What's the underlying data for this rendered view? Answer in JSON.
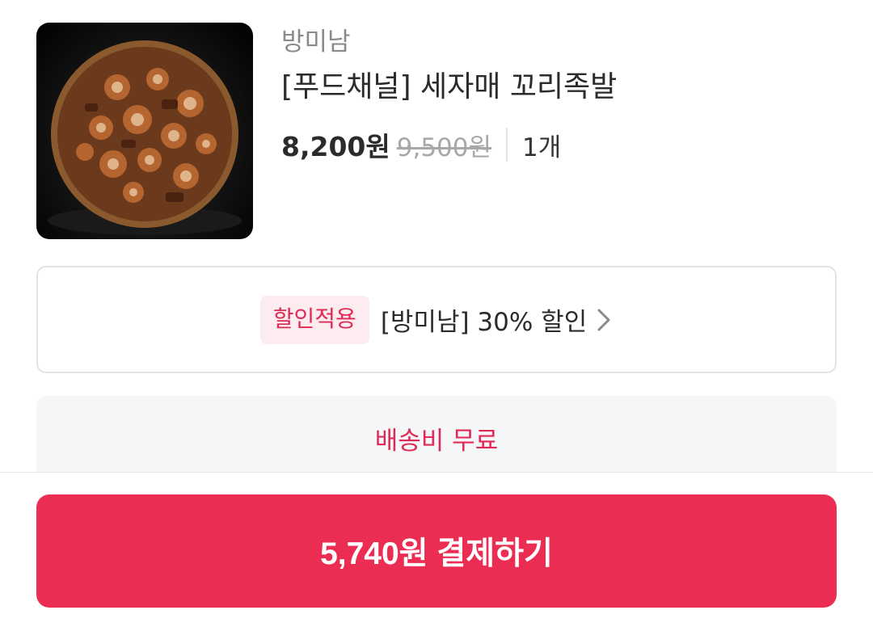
{
  "product": {
    "seller": "방미남",
    "title": "[푸드채널] 세자매 꼬리족발",
    "price": "8,200원",
    "original_price": "9,500원",
    "quantity": "1개",
    "image_alt": "food-photo"
  },
  "discount": {
    "badge": "할인적용",
    "text": "[방미남] 30% 할인",
    "icon": "chevron-right-icon"
  },
  "shipping": {
    "text": "배송비 무료"
  },
  "checkout": {
    "button_label": "5,740원 결제하기"
  },
  "colors": {
    "accent": "#ec2d53",
    "badge_bg": "#fdecef",
    "shipping_bg": "#f5f6f8"
  }
}
